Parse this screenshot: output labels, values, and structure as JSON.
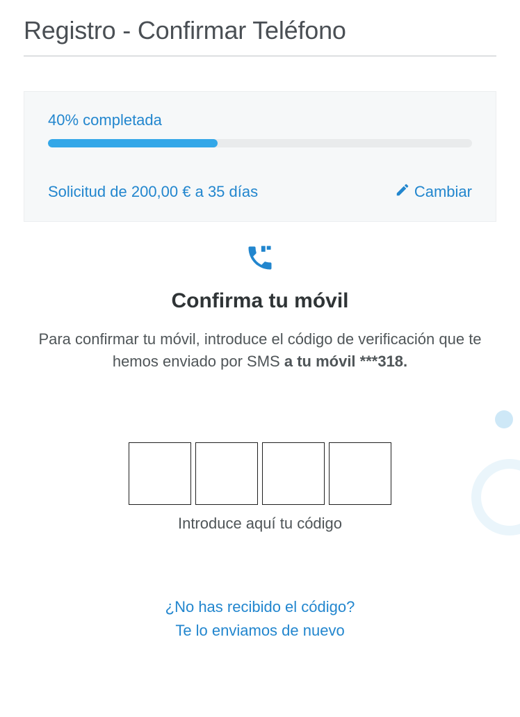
{
  "page": {
    "title": "Registro - Confirmar Teléfono"
  },
  "progress": {
    "label": "40% completada",
    "percent": 40,
    "request_text": "Solicitud de 200,00 € a 35 días",
    "change_label": "Cambiar"
  },
  "confirm": {
    "heading": "Confirma tu móvil",
    "instruction_prefix": "Para confirmar tu móvil, introduce el código de verificación que te hemos enviado por SMS ",
    "instruction_bold": "a tu móvil ***318."
  },
  "code": {
    "hint": "Introduce aquí tu código"
  },
  "resend": {
    "question": "¿No has recibido el código?",
    "action": "Te lo enviamos de nuevo"
  }
}
